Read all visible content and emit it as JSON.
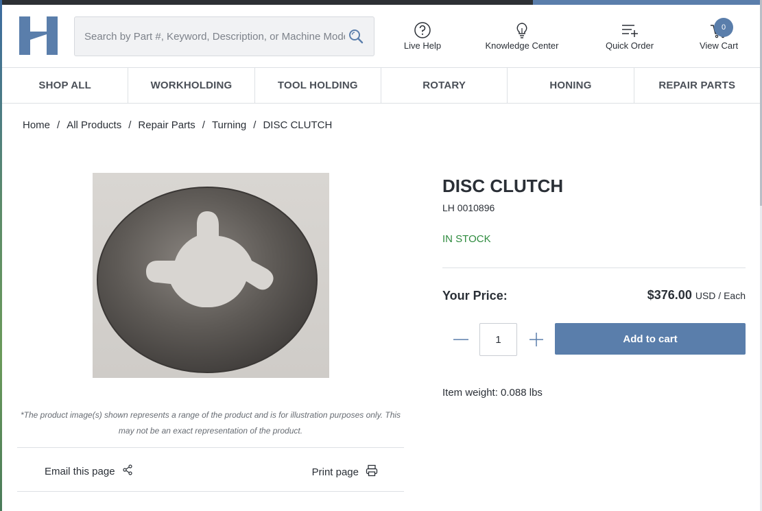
{
  "brand": {
    "accent": "#5a7eab",
    "stock_color": "#2e8b3e"
  },
  "search": {
    "placeholder": "Search by Part #, Keyword, Description, or Machine Model"
  },
  "header_nav": {
    "live_help": "Live Help",
    "knowledge_center": "Knowledge Center",
    "quick_order": "Quick Order",
    "view_cart": "View Cart",
    "cart_count": "0"
  },
  "categories": [
    "SHOP ALL",
    "WORKHOLDING",
    "TOOL HOLDING",
    "ROTARY",
    "HONING",
    "REPAIR PARTS"
  ],
  "breadcrumb": [
    "Home",
    "All Products",
    "Repair Parts",
    "Turning",
    "DISC CLUTCH"
  ],
  "breadcrumb_sep": "/",
  "product": {
    "title": "DISC CLUTCH",
    "sku": "LH 0010896",
    "stock": "IN STOCK",
    "price_label": "Your Price:",
    "price": "$376.00",
    "price_unit": "USD / Each",
    "quantity": "1",
    "add_to_cart": "Add to cart",
    "weight": "Item weight: 0.088 lbs"
  },
  "disclaimer": "*The product image(s) shown represents a range of the product and is for illustration purposes only. This may not be an exact representation of the product.",
  "share": {
    "email": "Email this page",
    "print": "Print page"
  }
}
